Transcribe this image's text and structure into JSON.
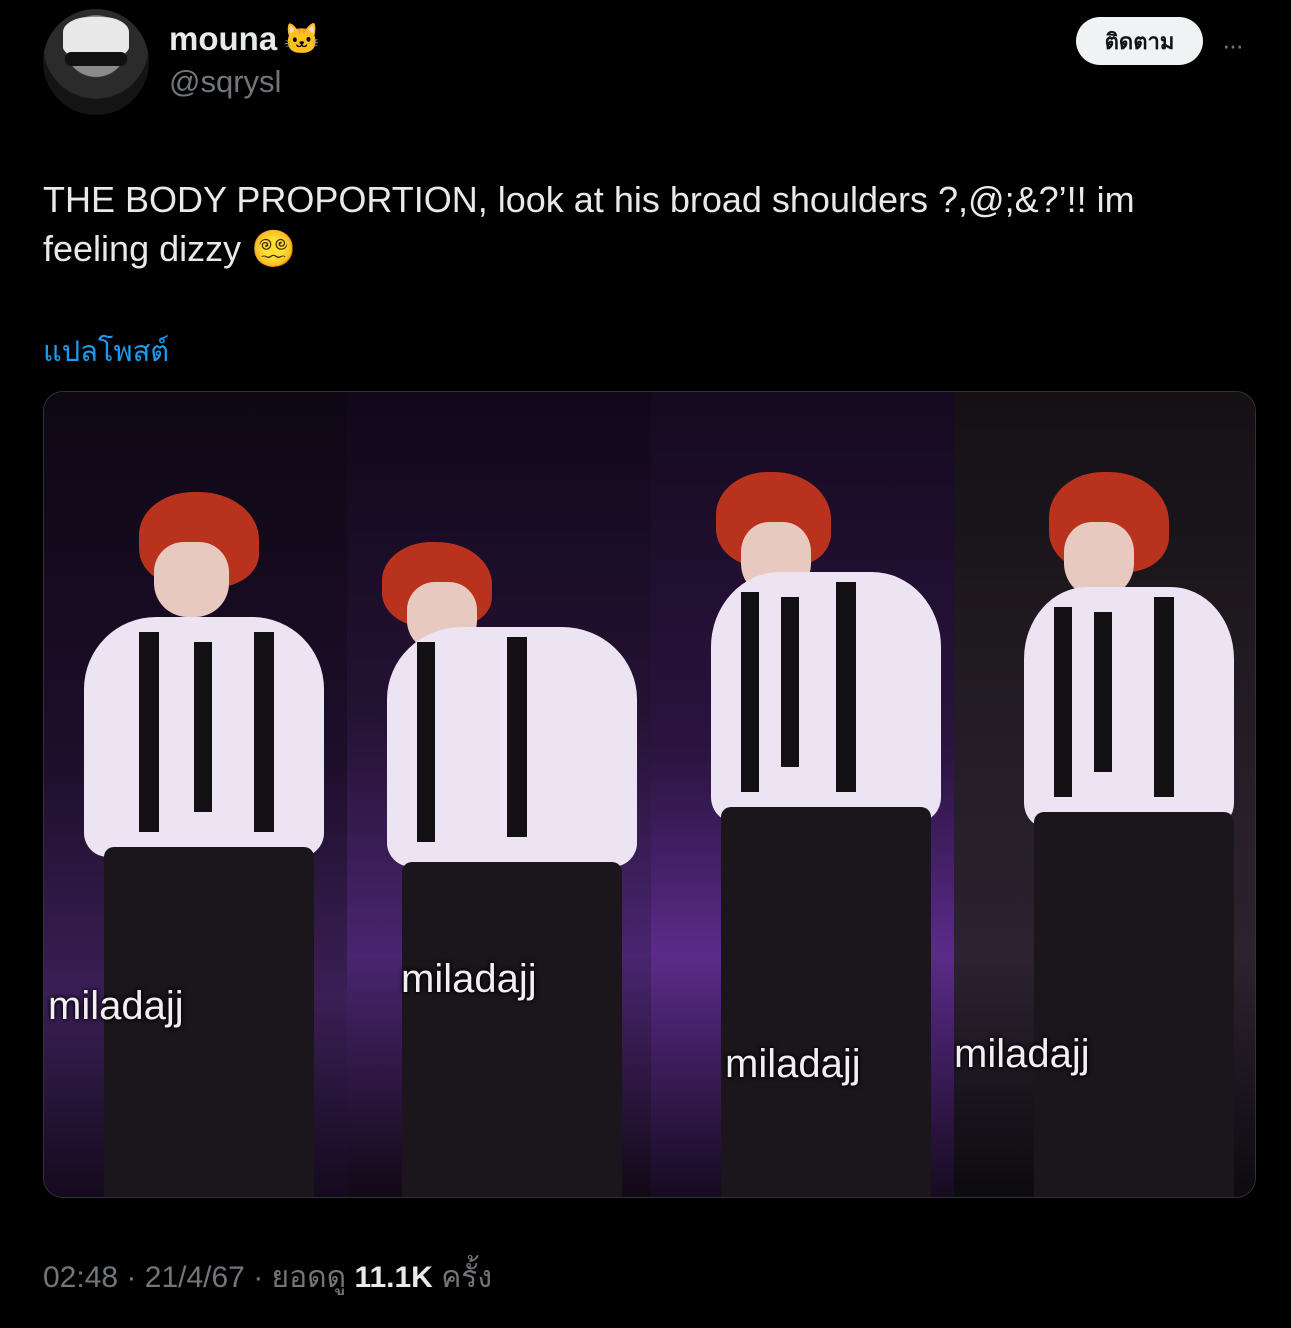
{
  "author": {
    "display_name": "mouna",
    "emoji": "🐱",
    "handle": "@sqrysl"
  },
  "follow_label": "ติดตาม",
  "more_icon": "···",
  "tweet": {
    "text_line1": "THE BODY PROPORTION, look at his broad shoulders ?,@;&?’!! im",
    "text_line2": "feeling dizzy 😵‍💫"
  },
  "translate_label": "แปลโพสต์",
  "media": {
    "watermarks": [
      "miladajj",
      "miladajj",
      "miladajj",
      "miladajj"
    ]
  },
  "meta": {
    "time": "02:48",
    "separator": "·",
    "date": "21/4/67",
    "views_label": "ยอดดู",
    "views_count": "11.1K",
    "views_suffix": "ครั้ง"
  }
}
